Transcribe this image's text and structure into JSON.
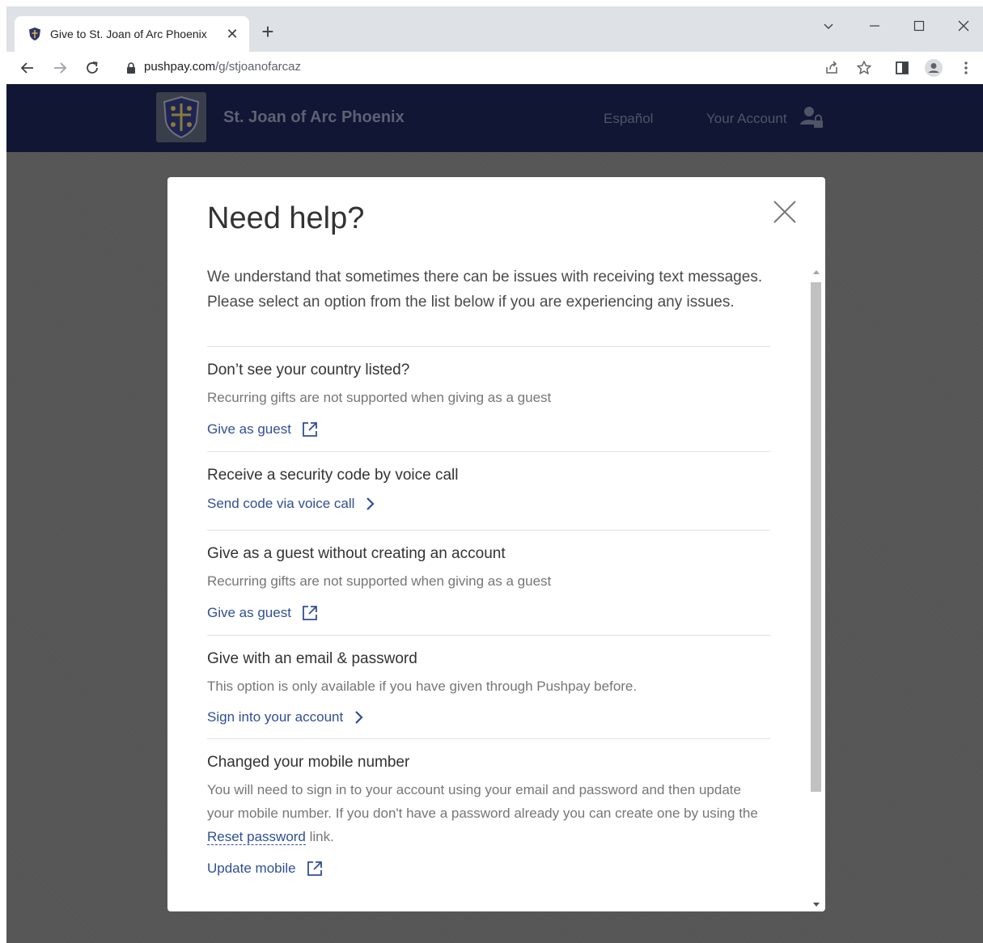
{
  "browser": {
    "tab": {
      "title": "Give to St. Joan of Arc Phoenix",
      "close": "✕"
    },
    "new_tab": "+",
    "url": {
      "host": "pushpay.com",
      "path": "/g/stjoanofarcaz"
    }
  },
  "site": {
    "name": "St. Joan of Arc Phoenix",
    "language_link": "Español",
    "account_link": "Your Account"
  },
  "modal": {
    "title": "Need help?",
    "intro": "We understand that sometimes there can be issues with receiving text messages. Please select an option from the list below if you are experiencing any issues.",
    "sections": [
      {
        "title": "Don’t see your country listed?",
        "description": "Recurring gifts are not supported when giving as a guest",
        "link": "Give as guest",
        "link_icon": "external-link-icon"
      },
      {
        "title": "Receive a security code by voice call",
        "link": "Send code via voice call",
        "link_icon": "chevron-right-icon"
      },
      {
        "title": "Give as a guest without creating an account",
        "description": "Recurring gifts are not supported when giving as a guest",
        "link": "Give as guest",
        "link_icon": "external-link-icon"
      },
      {
        "title": "Give with an email & password",
        "description": "This option is only available if you have given through Pushpay before.",
        "link": "Sign into your account",
        "link_icon": "chevron-right-icon"
      },
      {
        "title": "Changed your mobile number",
        "description_before": "You will need to sign in to your account using your email and password and then update your mobile number. If you don't have a password already you can create one by using the ",
        "description_link": "Reset password",
        "description_after": " link.",
        "link": "Update mobile",
        "link_icon": "external-link-icon"
      }
    ]
  },
  "colors": {
    "header_bg": "#101634",
    "link": "#2f4f95",
    "overlay": "#555555"
  }
}
